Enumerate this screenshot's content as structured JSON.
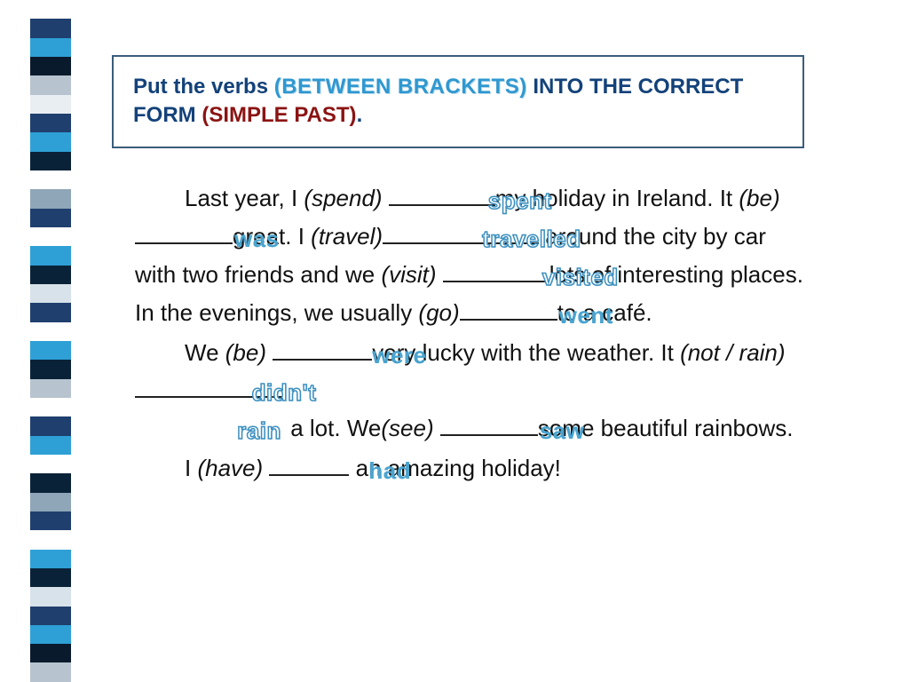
{
  "instruction": {
    "prefix": "Put the verbs ",
    "brackets": "(BETWEEN BRACKETS)",
    "mid": " INTO THE CORRECT FORM ",
    "tense": "(SIMPLE PAST)",
    "suffix": "."
  },
  "stripes": [
    "#ffffff",
    "#1f3f6e",
    "#2ea0d6",
    "#091a2c",
    "#b7c3cf",
    "#e9eef3",
    "#1f3f6e",
    "#2ea0d6",
    "#0a2238",
    "#ffffff",
    "#8fa6b8",
    "#1f3f6e",
    "#ffffff",
    "#2ea0d6",
    "#0a2238",
    "#d7e2ea",
    "#1f3f6e",
    "#ffffff",
    "#2ea0d6",
    "#0a2238",
    "#b7c3cf",
    "#ffffff",
    "#1f3f6e",
    "#2ea0d6",
    "#ffffff",
    "#0a2238",
    "#8fa6b8",
    "#1f3f6e",
    "#ffffff",
    "#2ea0d6",
    "#0a2238",
    "#d7e2ea",
    "#1f3f6e",
    "#2ea0d6",
    "#091a2c",
    "#b7c3cf"
  ],
  "text": {
    "p1a": "Last year, I ",
    "h1": "(spend)",
    "a1": "spent",
    "p1b": "my holiday in Ireland. It ",
    "h2": "(be)",
    "a2": "was",
    "p1c": "great. I ",
    "h3": "(travel)",
    "a3": "travelled",
    "p1d": " around the city by car with two friends and we ",
    "h4": "(visit)",
    "a4": "visited",
    "p1e": "lots of interesting places. In the evenings, we usually ",
    "h5": "(go)",
    "a5": "went",
    "p1f": "to a café.",
    "p2a": "We ",
    "h6": "(be)",
    "a6": "were",
    "p2b": "very lucky with the weather. It ",
    "h7": "(not / rain)",
    "a7": "didn't rain",
    "p2c": " a lot. We",
    "h8": "(see)",
    "a8": "saw",
    "p2d": "some beautiful rainbows.",
    "p3a": "I ",
    "h9": "(have)",
    "a9": "had",
    "p3b": " an amazing holiday!"
  }
}
